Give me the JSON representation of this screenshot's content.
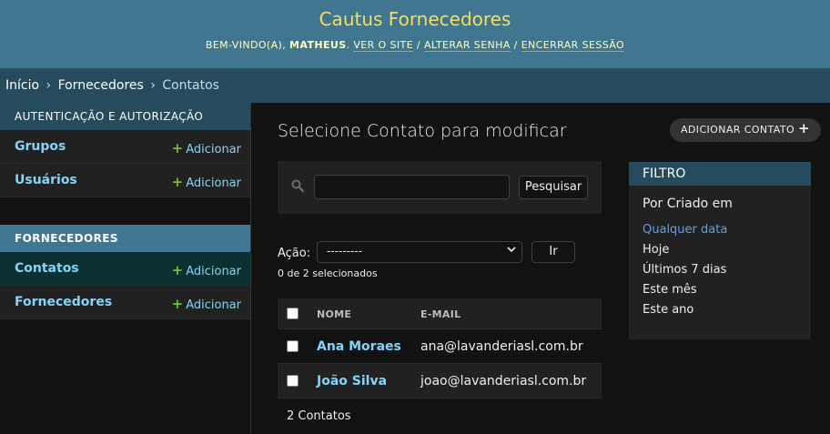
{
  "header": {
    "site_name": "Cautus Fornecedores",
    "welcome": "Bem-vindo(a),",
    "username": "Matheus",
    "view_site": "Ver o site",
    "change_password": "Alterar senha",
    "logout": "Encerrar sessão",
    "separator": "/"
  },
  "breadcrumbs": {
    "items": [
      "Início",
      "Fornecedores",
      "Contatos"
    ],
    "separator": "›"
  },
  "sidebar": {
    "modules": [
      {
        "caption": "Autenticação e Autorização",
        "models": [
          {
            "name": "Grupos",
            "add_label": "Adicionar"
          },
          {
            "name": "Usuários",
            "add_label": "Adicionar"
          }
        ]
      },
      {
        "caption": "Fornecedores",
        "models": [
          {
            "name": "Contatos",
            "add_label": "Adicionar",
            "current": true
          },
          {
            "name": "Fornecedores",
            "add_label": "Adicionar"
          }
        ]
      }
    ]
  },
  "content": {
    "title": "Selecione Contato para modificar",
    "add_button": "Adicionar Contato",
    "search": {
      "value": "",
      "button": "Pesquisar"
    },
    "actions": {
      "label": "Ação:",
      "selected": "---------",
      "go_button": "Ir",
      "counter": "0 de 2 selecionados"
    },
    "table": {
      "columns": [
        "Nome",
        "E-mail"
      ],
      "rows": [
        {
          "name": "Ana Moraes",
          "email": "ana@lavanderiasl.com.br"
        },
        {
          "name": "João Silva",
          "email": "joao@lavanderiasl.com.br"
        }
      ]
    },
    "paginator": "2 Contatos"
  },
  "filter": {
    "title": "Filtro",
    "heading": "Por Criado em",
    "options": [
      "Qualquer data",
      "Hoje",
      "Últimos 7 dias",
      "Este mês",
      "Este ano"
    ],
    "selected": "Qualquer data"
  },
  "colors": {
    "header_bg": "#417690",
    "brand": "#f5dd5d",
    "breadcrumb_bg": "#264b5d",
    "link": "#81d4fa",
    "add_plus": "#70bf2b",
    "selected_filter": "#6a9dd8"
  }
}
